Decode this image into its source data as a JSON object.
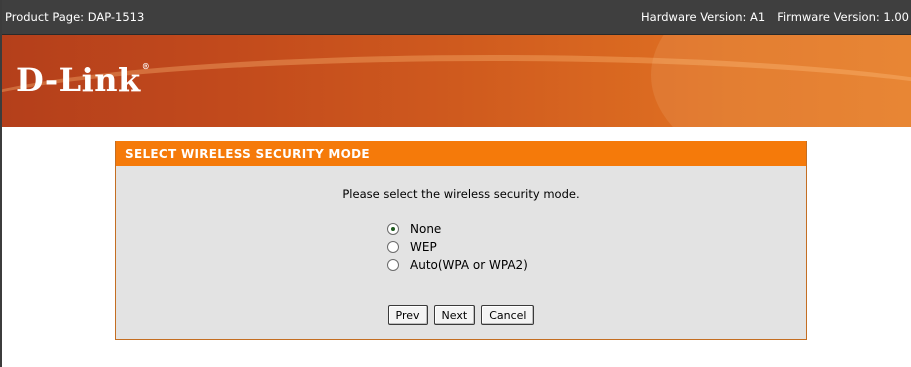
{
  "topbar": {
    "product": "Product Page: DAP-1513",
    "hardware": "Hardware Version: A1",
    "firmware": "Firmware Version: 1.00"
  },
  "banner": {
    "logo_text": "D-Link",
    "logo_mark": "®"
  },
  "wizard": {
    "title": "SELECT WIRELESS SECURITY MODE",
    "prompt": "Please select the wireless security mode.",
    "options": [
      {
        "label": "None",
        "selected": true
      },
      {
        "label": "WEP",
        "selected": false
      },
      {
        "label": "Auto(WPA or WPA2)",
        "selected": false
      }
    ],
    "buttons": {
      "prev": "Prev",
      "next": "Next",
      "cancel": "Cancel"
    }
  },
  "colors": {
    "topbar": "#3f3f3f",
    "banner_start": "#b43f1b",
    "banner_end": "#e57a24",
    "wizard_header": "#f57a0a",
    "wizard_body": "#e3e3e3"
  }
}
